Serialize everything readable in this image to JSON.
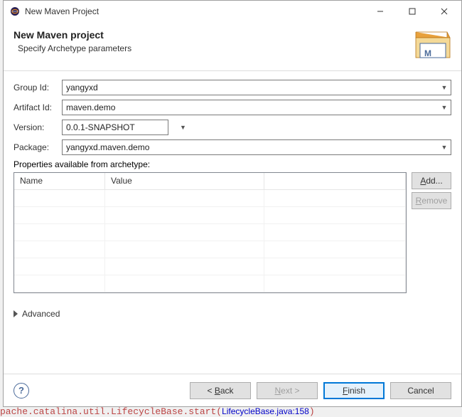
{
  "titlebar": {
    "title": "New Maven Project"
  },
  "header": {
    "title": "New Maven project",
    "subtitle": "Specify Archetype parameters"
  },
  "labels": {
    "groupId": "Group Id:",
    "artifactId": "Artifact Id:",
    "version": "Version:",
    "package": "Package:",
    "properties": "Properties available from archetype:",
    "advanced": "Advanced"
  },
  "fields": {
    "groupId": "yangyxd",
    "artifactId": "maven.demo",
    "version": "0.0.1-SNAPSHOT",
    "package": "yangyxd.maven.demo"
  },
  "table": {
    "headers": {
      "name": "Name",
      "value": "Value"
    }
  },
  "sideButtons": {
    "add": "Add...",
    "add_mnemonic": "A",
    "remove": "Remove",
    "remove_mnemonic": "R"
  },
  "footer": {
    "back": "Back",
    "back_mnemonic": "B",
    "next": "Next >",
    "next_mnemonic": "N",
    "finish": "Finish",
    "finish_mnemonic": "F",
    "cancel": "Cancel"
  },
  "help": {
    "glyph": "?"
  },
  "background_text": "pache.catalina.util.LifecycleBase.start(LifecycleBase.java:158)"
}
